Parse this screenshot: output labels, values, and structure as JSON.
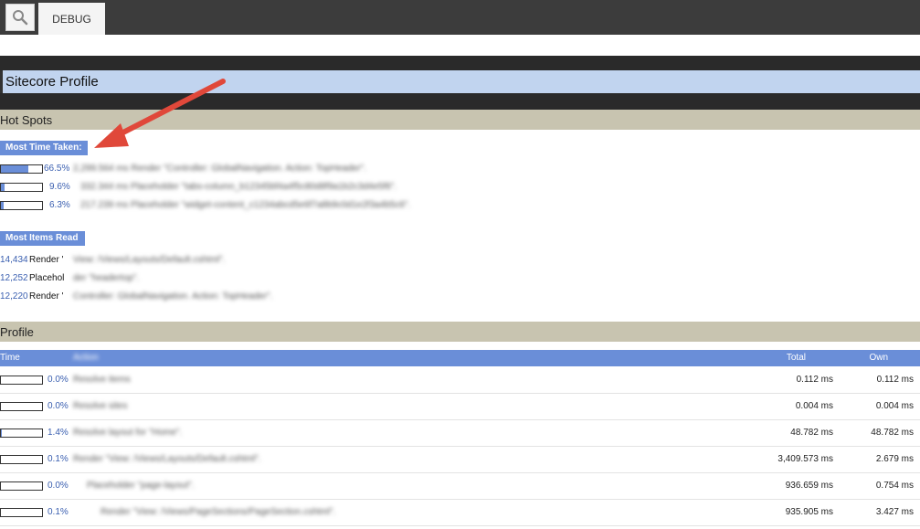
{
  "toolbar": {
    "search_icon": "search-icon",
    "tab_label": "DEBUG"
  },
  "title": "Sitecore Profile",
  "hot_spots": {
    "heading": "Hot Spots",
    "most_time": {
      "label": "Most Time Taken",
      "rows": [
        {
          "pct": "66.5%",
          "fraction": 0.665,
          "text": "2,299.564 ms Render \"Controller: GlobalNavigation. Action: TopHeader\"."
        },
        {
          "pct": "9.6%",
          "fraction": 0.096,
          "text": "332.344 ms Placeholder \"tabs-column_b12345bf4a4f5c80d8f9a1b2c3d4e5f6\"."
        },
        {
          "pct": "6.3%",
          "fraction": 0.063,
          "text": "217.239 ms Placeholder \"widget-content_c1234abcd5e6f7a8b9c0d1e2f3a4b5c6\"."
        }
      ]
    },
    "most_items": {
      "label": "Most Items Read",
      "rows": [
        {
          "count": "14,434",
          "kind": "Render '",
          "text": "View: /Views/Layouts/Default.cshtml\"."
        },
        {
          "count": "12,252",
          "kind": "Placehol",
          "text": "der \"headertop\"."
        },
        {
          "count": "12,220",
          "kind": "Render '",
          "text": "Controller: GlobalNavigation. Action: TopHeader\"."
        }
      ]
    }
  },
  "profile": {
    "heading": "Profile",
    "columns": {
      "time": "Time",
      "action": "Action",
      "total": "Total",
      "own": "Own"
    },
    "rows": [
      {
        "pct": "0.0%",
        "fraction": 0.0,
        "action": "Resolve items",
        "total": "0.112 ms",
        "own": "0.112 ms"
      },
      {
        "pct": "0.0%",
        "fraction": 0.0,
        "action": "Resolve sites",
        "total": "0.004 ms",
        "own": "0.004 ms"
      },
      {
        "pct": "1.4%",
        "fraction": 0.014,
        "action": "Resolve layout for \"Home\".",
        "total": "48.782 ms",
        "own": "48.782 ms"
      },
      {
        "pct": "0.1%",
        "fraction": 0.001,
        "action": "Render \"View: /Views/Layouts/Default.cshtml\".",
        "total": "3,409.573 ms",
        "own": "2.679 ms"
      },
      {
        "pct": "0.0%",
        "fraction": 0.0,
        "action": "Placeholder \"page-layout\".",
        "total": "936.659 ms",
        "own": "0.754 ms"
      },
      {
        "pct": "0.1%",
        "fraction": 0.001,
        "action": "Render \"View: /Views/PageSections/PageSection.cshtml\".",
        "total": "935.905 ms",
        "own": "3.427 ms"
      }
    ]
  },
  "colors": {
    "accent": "#6a8ed8",
    "title_bg": "#c1d4ef",
    "section_bg": "#c8c4b0",
    "annotation_arrow": "#e0483a"
  }
}
